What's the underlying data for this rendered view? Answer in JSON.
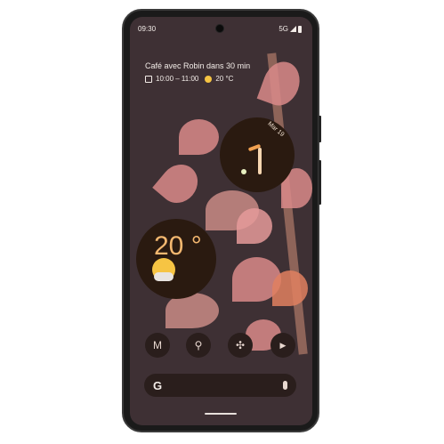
{
  "status_bar": {
    "time": "09:30",
    "network": "5G"
  },
  "at_a_glance": {
    "title": "Café avec Robin dans 30 min",
    "time_range": "10:00 – 11:00",
    "temperature": "20 °C"
  },
  "clock_widget": {
    "date": "Mar 19"
  },
  "weather_widget": {
    "temperature": "20 °"
  },
  "dock": [
    {
      "icon": "gmail-icon",
      "glyph": "M"
    },
    {
      "icon": "maps-icon",
      "glyph": "⚲"
    },
    {
      "icon": "photos-icon",
      "glyph": "✣"
    },
    {
      "icon": "youtube-icon",
      "glyph": "▶"
    }
  ],
  "search": {
    "logo": "G",
    "mic": "🎤"
  },
  "colors": {
    "screen": "#3e3034",
    "widget": "#2a1a10",
    "accent": "#f0a050"
  }
}
